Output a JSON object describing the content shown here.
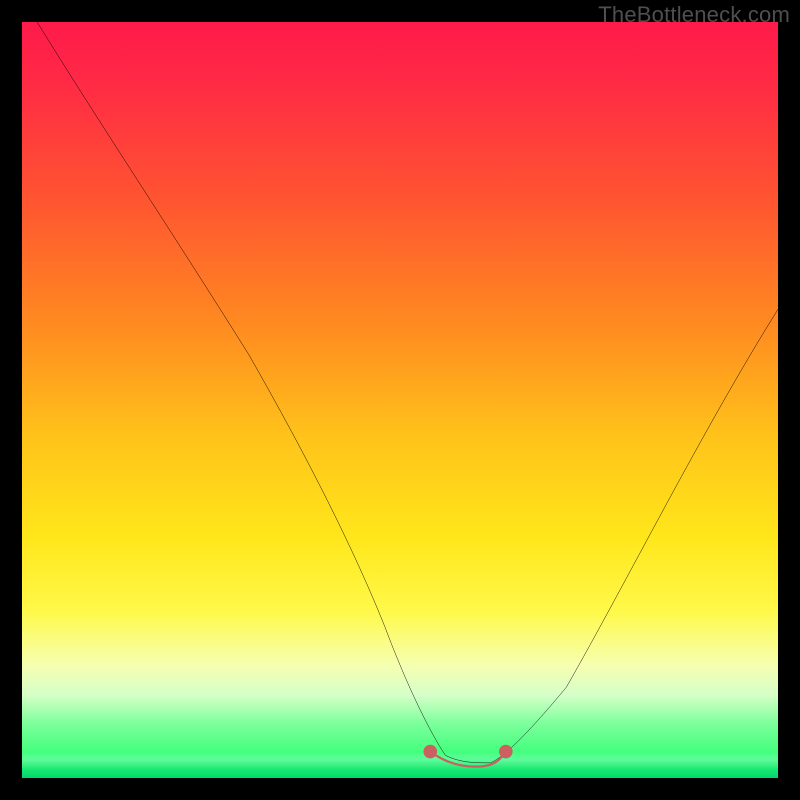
{
  "watermark": "TheBottleneck.com",
  "chart_data": {
    "type": "line",
    "title": "",
    "xlabel": "",
    "ylabel": "",
    "xlim": [
      0,
      100
    ],
    "ylim": [
      0,
      100
    ],
    "series": [
      {
        "name": "bottleneck-curve",
        "x": [
          2,
          10,
          20,
          30,
          38,
          44,
          48,
          51,
          54,
          56,
          58,
          60,
          62,
          64,
          67,
          72,
          80,
          90,
          100
        ],
        "values": [
          100,
          87,
          72,
          56,
          42,
          30,
          20,
          12,
          6,
          3,
          2,
          2,
          2,
          3,
          6,
          12,
          26,
          46,
          62
        ]
      },
      {
        "name": "highlight-range",
        "x": [
          54,
          56,
          58,
          60,
          62,
          64
        ],
        "values": [
          3.5,
          2,
          1.5,
          1.5,
          2,
          3.5
        ]
      }
    ],
    "gradient_stops": [
      {
        "pct": 0,
        "color": "#ff1a4a"
      },
      {
        "pct": 24,
        "color": "#ff5630"
      },
      {
        "pct": 55,
        "color": "#ffc31a"
      },
      {
        "pct": 78,
        "color": "#fff94a"
      },
      {
        "pct": 93,
        "color": "#78ff9a"
      },
      {
        "pct": 100,
        "color": "#00d86a"
      }
    ]
  }
}
